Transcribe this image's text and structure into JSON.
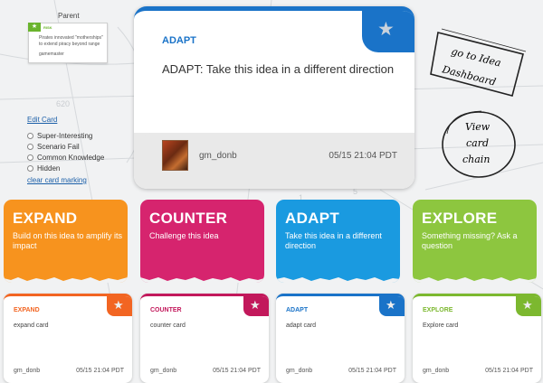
{
  "parent": {
    "label": "Parent",
    "card_type": "RISK",
    "text": "Pirates innovated \"motherships\" to extend piracy beyond range",
    "user": "gamemaster"
  },
  "card_options": {
    "edit_link": "Edit Card",
    "options": [
      "Super-Interesting",
      "Scenario Fail",
      "Common Knowledge",
      "Hidden"
    ],
    "clear_link": "clear card marking"
  },
  "main_card": {
    "type": "ADAPT",
    "text": "ADAPT: Take this idea in a different direction",
    "user": "gm_donb",
    "time": "05/15 21:04 PDT",
    "accent": "#1a73c8"
  },
  "links": {
    "dashboard_line1": "go to Idea",
    "dashboard_line2": "Dashboard",
    "chain_line1": "View",
    "chain_line2": "card",
    "chain_line3": "chain"
  },
  "categories": [
    {
      "title": "EXPAND",
      "desc": "Build on this idea to amplify its impact",
      "color": "#f7931e"
    },
    {
      "title": "COUNTER",
      "desc": "Challenge this idea",
      "color": "#d6246e"
    },
    {
      "title": "ADAPT",
      "desc": "Take this idea in a different direction",
      "color": "#1a9ae0"
    },
    {
      "title": "EXPLORE",
      "desc": "Something missing? Ask a question",
      "color": "#8dc63f"
    }
  ],
  "small_cards": [
    {
      "type": "EXPAND",
      "text": "expand card",
      "user": "gm_donb",
      "time": "05/15 21:04 PDT",
      "color": "#f26522"
    },
    {
      "type": "COUNTER",
      "text": "counter card",
      "user": "gm_donb",
      "time": "05/15 21:04 PDT",
      "color": "#c2185b"
    },
    {
      "type": "ADAPT",
      "text": "adapt card",
      "user": "gm_donb",
      "time": "05/15 21:04 PDT",
      "color": "#1a73c8"
    },
    {
      "type": "EXPLORE",
      "text": "Explore card",
      "user": "gm_donb",
      "time": "05/15 21:04 PDT",
      "color": "#7cb82f"
    }
  ]
}
